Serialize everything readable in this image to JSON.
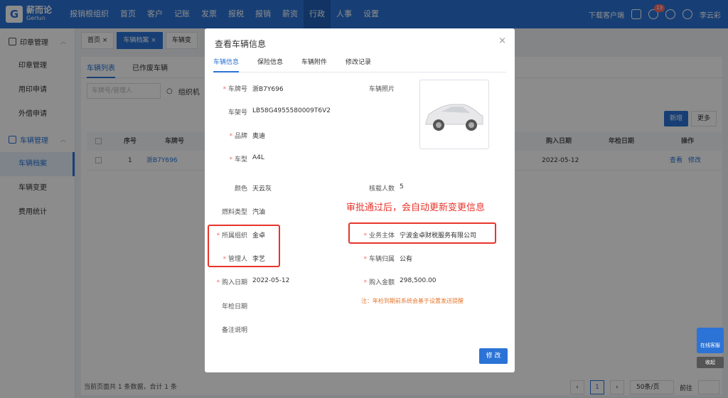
{
  "app": {
    "logo_cn": "薪而论",
    "logo_en": "Gerlun"
  },
  "nav": [
    "报销根组织",
    "首页",
    "客户",
    "记账",
    "发票",
    "报税",
    "报销",
    "薪资",
    "行政",
    "人事",
    "设置"
  ],
  "topbar": {
    "download": "下载客户端",
    "notification_count": "13",
    "user": "李云彩"
  },
  "sidebar": {
    "groups": [
      {
        "label": "印章管理",
        "items": [
          "印章管理",
          "用印申请",
          "外借申请"
        ]
      },
      {
        "label": "车辆管理",
        "items": [
          "车辆档案",
          "车辆变更",
          "费用统计"
        ]
      }
    ]
  },
  "tabs": [
    "首页",
    "车辆档案",
    "车辆变"
  ],
  "list": {
    "subtabs": [
      "车辆列表",
      "已作废车辆"
    ],
    "search_placeholder": "车牌号/管理人",
    "org_label": "组织机",
    "new_btn": "新增",
    "more_btn": "更多",
    "columns": [
      "序号",
      "车牌号",
      "购入日期",
      "年检日期",
      "操作"
    ],
    "rows": [
      {
        "index": "1",
        "plate": "浙B7Y696",
        "buy_date": "2022-05-12",
        "inspect": "",
        "view": "查看",
        "edit": "修改"
      }
    ],
    "summary": "当前页面共 1 条数据，合计 1 条",
    "page": "1",
    "page_size": "50条/页",
    "goto": "前往"
  },
  "widget": {
    "service": "在线客服",
    "collapse": "收起"
  },
  "modal": {
    "title": "查看车辆信息",
    "close": "×",
    "tabs": [
      "车辆信息",
      "保险信息",
      "车辆附件",
      "修改记录"
    ],
    "fields": {
      "plate": {
        "label": "车牌号",
        "value": "浙B7Y696"
      },
      "frame": {
        "label": "车架号",
        "value": "LB58G4955580009T6V2"
      },
      "brand": {
        "label": "品牌",
        "value": "奥迪"
      },
      "model": {
        "label": "车型",
        "value": "A4L"
      },
      "color": {
        "label": "颜色",
        "value": "天云灰"
      },
      "fuel": {
        "label": "燃料类型",
        "value": "汽油"
      },
      "org": {
        "label": "所属组织",
        "value": "金卓"
      },
      "manager": {
        "label": "管理人",
        "value": "李艺"
      },
      "buy_date": {
        "label": "购入日期",
        "value": "2022-05-12"
      },
      "inspect": {
        "label": "年检日期",
        "value": ""
      },
      "remark": {
        "label": "备注说明",
        "value": ""
      },
      "photo": {
        "label": "车辆照片"
      },
      "seats": {
        "label": "核载人数",
        "value": "5"
      },
      "entity": {
        "label": "业务主体",
        "value": "宁波金卓财税服务有限公司"
      },
      "ownership": {
        "label": "车辆归属",
        "value": "公有"
      },
      "amount": {
        "label": "购入金额",
        "value": "298,500.00"
      }
    },
    "annotation": "审批通过后，会自动更新变更信息",
    "note": "注：年检到期前系统会基于设置发送提醒",
    "edit_btn": "修 改"
  }
}
